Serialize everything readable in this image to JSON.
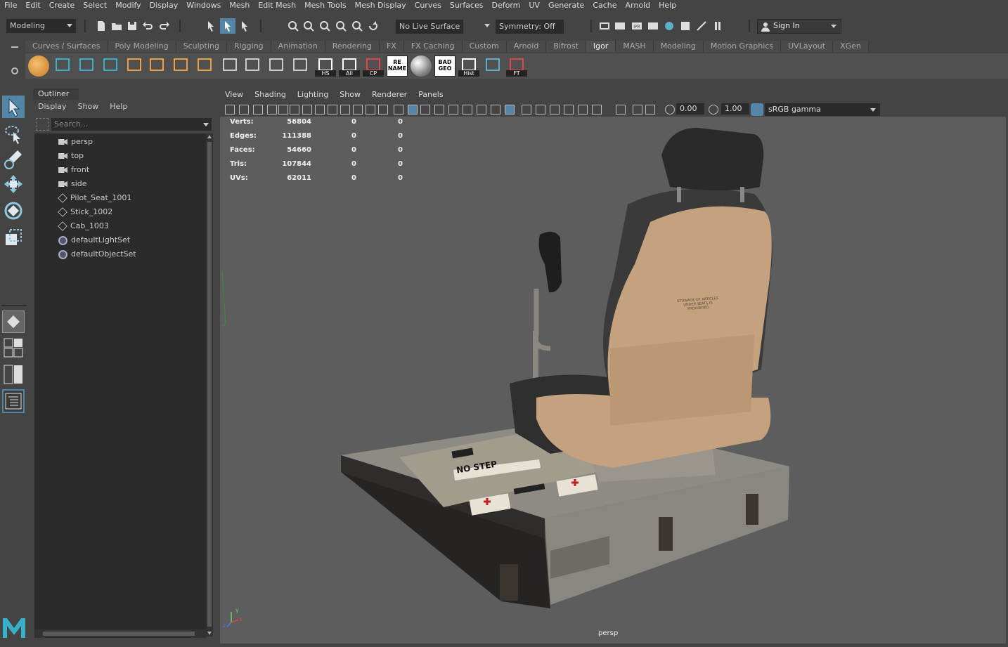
{
  "menubar": [
    "File",
    "Edit",
    "Create",
    "Select",
    "Modify",
    "Display",
    "Windows",
    "Mesh",
    "Edit Mesh",
    "Mesh Tools",
    "Mesh Display",
    "Curves",
    "Surfaces",
    "Deform",
    "UV",
    "Generate",
    "Cache",
    "Arnold",
    "Help"
  ],
  "statusline": {
    "menuset": "Modeling",
    "live_surface": "No Live Surface",
    "symmetry": "Symmetry: Off",
    "sign_in": "Sign In"
  },
  "shelf": {
    "tabs": [
      "Curves / Surfaces",
      "Poly Modeling",
      "Sculpting",
      "Rigging",
      "Animation",
      "Rendering",
      "FX",
      "FX Caching",
      "Custom",
      "Arnold",
      "Bifrost",
      "Igor",
      "MASH",
      "Modeling",
      "Motion Graphics",
      "UVLayout",
      "XGen"
    ],
    "active_tab": "Igor",
    "labels": {
      "hs": "HS",
      "all": "All",
      "cp": "CP",
      "rename": "RE\nNAME",
      "badgeo": "BAD\nGEO",
      "hist": "Hist",
      "ft": "FT"
    }
  },
  "outliner": {
    "title": "Outliner",
    "menu": [
      "Display",
      "Show",
      "Help"
    ],
    "search_placeholder": "Search...",
    "items": [
      {
        "label": "persp",
        "icon": "camera-icon"
      },
      {
        "label": "top",
        "icon": "camera-icon"
      },
      {
        "label": "front",
        "icon": "camera-icon"
      },
      {
        "label": "side",
        "icon": "camera-icon"
      },
      {
        "label": "Pilot_Seat_1001",
        "icon": "mesh-icon"
      },
      {
        "label": "Stick_1002",
        "icon": "mesh-icon"
      },
      {
        "label": "Cab_1003",
        "icon": "mesh-icon"
      },
      {
        "label": "defaultLightSet",
        "icon": "set-icon"
      },
      {
        "label": "defaultObjectSet",
        "icon": "set-icon"
      }
    ]
  },
  "viewport": {
    "menu": [
      "View",
      "Shading",
      "Lighting",
      "Show",
      "Renderer",
      "Panels"
    ],
    "exposure": "0.00",
    "gamma": "1.00",
    "color_space": "sRGB gamma",
    "camera": "persp",
    "hud": [
      {
        "label": "Verts:",
        "a": "56804",
        "b": "0",
        "c": "0"
      },
      {
        "label": "Edges:",
        "a": "111388",
        "b": "0",
        "c": "0"
      },
      {
        "label": "Faces:",
        "a": "54660",
        "b": "0",
        "c": "0"
      },
      {
        "label": "Tris:",
        "a": "107844",
        "b": "0",
        "c": "0"
      },
      {
        "label": "UVs:",
        "a": "62011",
        "b": "0",
        "c": "0"
      }
    ],
    "decals": {
      "no_step": "NO STEP",
      "stowage": "STOWAGE OF ARTICLES\nUNDER SEATS IS\nPROHIBITED"
    }
  },
  "colors": {
    "accent": "#5285a6",
    "seat_tan": "#c4a17f",
    "seat_dark": "#3a3a3a",
    "floor": "#8e8b84"
  }
}
